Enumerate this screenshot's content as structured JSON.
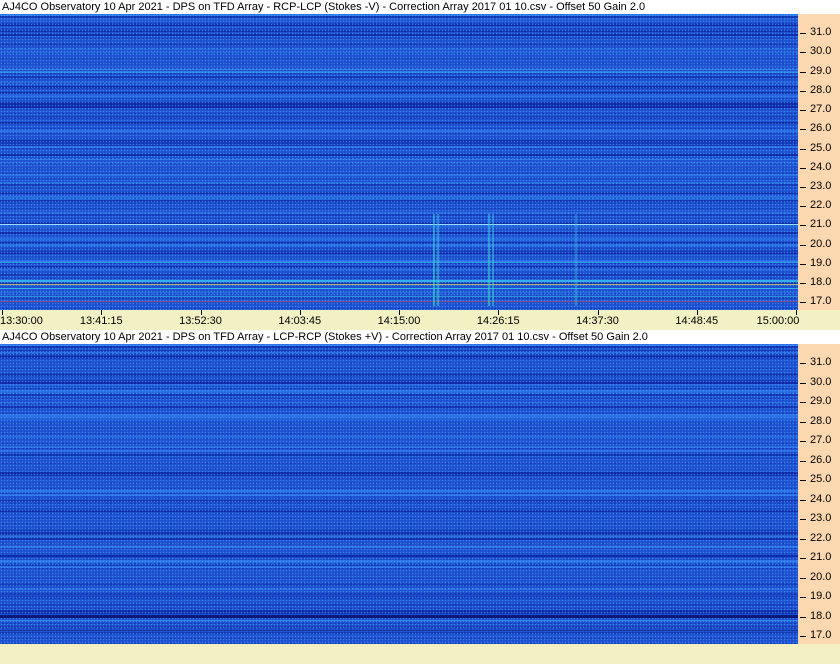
{
  "panels": [
    {
      "title": "AJ4CO Observatory 10 Apr 2021  -  DPS on TFD Array  -  RCP-LCP (Stokes -V)  -  Correction Array 2017 01 10.csv  -  Offset 50  Gain 2.0",
      "base_color": "#1d4fd0"
    },
    {
      "title": "AJ4CO Observatory 10 Apr 2021  -  DPS on TFD Array  -  LCP-RCP (Stokes +V)  -  Correction Array 2017 01 10.csv  -  Offset 50  Gain 2.0",
      "base_color": "#1e56cf"
    }
  ],
  "chart_data": {
    "type": "heatmap",
    "ylabel": "",
    "xlabel": "",
    "y_ticks": [
      "31.0",
      "30.0",
      "29.0",
      "28.0",
      "27.0",
      "26.0",
      "25.0",
      "24.0",
      "23.0",
      "22.0",
      "21.0",
      "20.0",
      "19.0",
      "18.0",
      "17.0"
    ],
    "y_tick_values": [
      31,
      30,
      29,
      28,
      27,
      26,
      25,
      24,
      23,
      22,
      21,
      20,
      19,
      18,
      17
    ],
    "ylim": [
      16.6,
      32.0
    ],
    "x_ticks": [
      "13:30:00",
      "13:41:15",
      "13:52:30",
      "14:03:45",
      "14:15:00",
      "14:26:15",
      "14:37:30",
      "14:48:45",
      "15:00:00"
    ],
    "xlim": [
      "13:30:00",
      "15:00:00"
    ],
    "colormap": [
      "#0b1fa0",
      "#1d4fd0",
      "#2f7ff0",
      "#3cc8f0",
      "#f0e040",
      "#f04040"
    ]
  }
}
